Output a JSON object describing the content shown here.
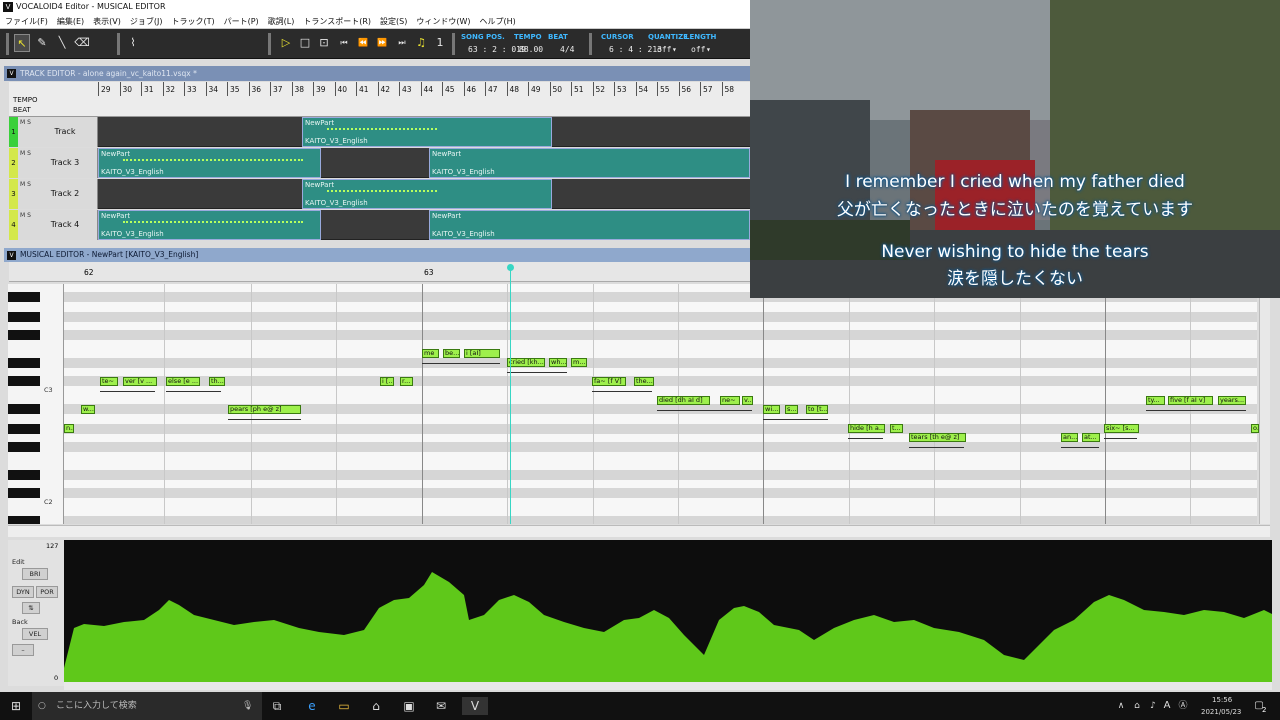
{
  "window": {
    "title": "VOCALOID4 Editor - MUSICAL EDITOR",
    "logo": "V"
  },
  "menu": [
    "ファイル(F)",
    "編集(E)",
    "表示(V)",
    "ジョブ(J)",
    "トラック(T)",
    "パート(P)",
    "歌詞(L)",
    "トランスポート(R)",
    "設定(S)",
    "ウィンドウ(W)",
    "ヘルプ(H)"
  ],
  "toolbar": {
    "song_pos_label": "SONG POS.",
    "song_pos": "63 : 2 : 019",
    "tempo_label": "TEMPO",
    "tempo": "88.00",
    "beat_label": "BEAT",
    "beat": "4/4",
    "cursor_label": "CURSOR",
    "cursor": "6 : 4 : 213",
    "quantize_label": "QUANTIZE",
    "quantize": "off",
    "length_label": "LENGTH",
    "length": "off",
    "icons": [
      "pointer-icon",
      "pencil-icon",
      "line-icon",
      "eraser-icon",
      "vibrato-tool-icon",
      "play-icon",
      "stop-icon",
      "loop-icon",
      "rewind-start-icon",
      "rewind-icon",
      "fast-forward-icon",
      "forward-end-icon",
      "metronome-icon",
      "one-icon"
    ]
  },
  "track_editor": {
    "title": "TRACK EDITOR - alone again_vc_kaito11.vsqx *",
    "ruler_labels": [
      "TEMPO",
      "BEAT"
    ],
    "measures": [
      "29",
      "30",
      "31",
      "32",
      "33",
      "34",
      "35",
      "36",
      "37",
      "38",
      "39",
      "40",
      "41",
      "42",
      "43",
      "44",
      "45",
      "46",
      "47",
      "48",
      "49",
      "50",
      "51",
      "52",
      "53",
      "54",
      "55",
      "56",
      "57",
      "58"
    ],
    "tracks": [
      {
        "num": "1",
        "name": "Track",
        "parts": [
          {
            "name": "NewPart",
            "singer": "KAITO_V3_English"
          }
        ]
      },
      {
        "num": "2",
        "name": "Track 3",
        "parts": [
          {
            "name": "NewPart",
            "singer": "KAITO_V3_English"
          },
          {
            "name": "NewPart",
            "singer": "KAITO_V3_English"
          }
        ]
      },
      {
        "num": "3",
        "name": "Track 2",
        "parts": [
          {
            "name": "NewPart",
            "singer": "KAITO_V3_English"
          }
        ]
      },
      {
        "num": "4",
        "name": "Track 4",
        "parts": [
          {
            "name": "NewPart",
            "singer": "KAITO_V3_English"
          },
          {
            "name": "NewPart",
            "singer": "KAITO_V3_English"
          }
        ]
      }
    ],
    "ms_label": "M S"
  },
  "musical_editor": {
    "title": "MUSICAL EDITOR - NewPart [KAITO_V3_English]",
    "measure_labels": [
      "62",
      "63"
    ],
    "octaves": [
      "C3",
      "C2"
    ],
    "notes": [
      "n...",
      "w...",
      "te~",
      "ver [v ...",
      "else [e ...",
      "th...",
      "pears [ph e@ z]",
      "me",
      "be...",
      "i [aI]",
      "cried [kh...",
      "wh...",
      "m...",
      "i [...",
      "r...",
      "fa~ [f V]",
      "the...",
      "died [dh aI d]",
      "ne~",
      "v...",
      "wi...",
      "s...",
      "to [t...",
      "hide [h a...",
      "t...",
      "tears [th e@ z]",
      "an...",
      "at...",
      "six~ [s...",
      "ty...",
      "five [f aI v]",
      "years...",
      "o..."
    ]
  },
  "control": {
    "max": "127",
    "min": "0",
    "edit_label": "Edit",
    "edit_value": "BRI",
    "dyn": "DYN",
    "por": "POR",
    "back_label": "Back",
    "back_value": "VEL"
  },
  "video": {
    "sub_en_1": "I remember I cried when my father died",
    "sub_jp_1": "父が亡くなったときに泣いたのを覚えています",
    "sub_en_2": "Never wishing to hide the tears",
    "sub_jp_2": "涙を隠したくない"
  },
  "taskbar": {
    "search_placeholder": "ここに入力して検索",
    "time": "15:56",
    "date": "2021/05/23",
    "ime": "A",
    "notification_count": "2"
  },
  "colors": {
    "note_green": "#9ef04c",
    "part_teal": "#2e8e84",
    "playhead": "#37d6c4",
    "dynamics_green": "#5fc81a",
    "accent_blue": "#3fb8ff"
  }
}
